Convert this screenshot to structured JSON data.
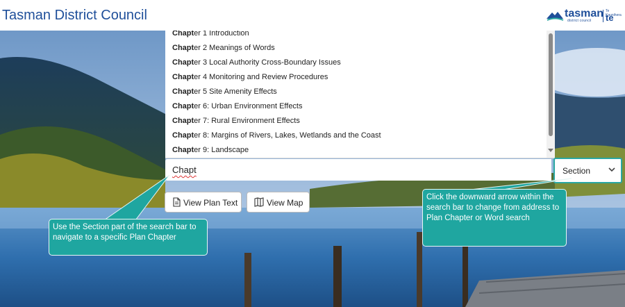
{
  "header": {
    "site_title": "Tasman District Council",
    "logo": {
      "wordmark": "tasman",
      "sub": "district council",
      "maori_sub": "Te Kaunihera",
      "maori_word": "te tai"
    }
  },
  "dropdown": {
    "match_text": "Chapt",
    "items": [
      {
        "prefix": "Chapt",
        "rest": "er 1 Introduction"
      },
      {
        "prefix": "Chapt",
        "rest": "er 2 Meanings of Words"
      },
      {
        "prefix": "Chapt",
        "rest": "er 3 Local Authority Cross-Boundary Issues"
      },
      {
        "prefix": "Chapt",
        "rest": "er 4 Monitoring and Review Procedures"
      },
      {
        "prefix": "Chapt",
        "rest": "er 5 Site Amenity Effects"
      },
      {
        "prefix": "Chapt",
        "rest": "er 6: Urban Environment Effects"
      },
      {
        "prefix": "Chapt",
        "rest": "er 7: Rural Environment Effects"
      },
      {
        "prefix": "Chapt",
        "rest": "er 8: Margins of Rivers, Lakes, Wetlands and the Coast"
      },
      {
        "prefix": "Chapt",
        "rest": "er 9: Landscape"
      }
    ]
  },
  "search": {
    "value": "Chapt",
    "mode": "Section"
  },
  "buttons": {
    "plan_text": "View Plan Text",
    "map": "View Map"
  },
  "callouts": {
    "left": "Use the Section part of the search bar to navigate to a specific Plan Chapter",
    "right": "Click the downward arrow within the search bar to change from address to Plan Chapter or Word search"
  },
  "colors": {
    "brand_blue": "#1f4f9a",
    "callout_teal": "#1fa6a0",
    "highlight_border": "#2aa7a2"
  },
  "icons": {
    "section_dropdown": "chevron-down-icon",
    "plan_text_button": "document-icon",
    "map_button": "map-icon",
    "logo": "mountain-logo-icon"
  }
}
